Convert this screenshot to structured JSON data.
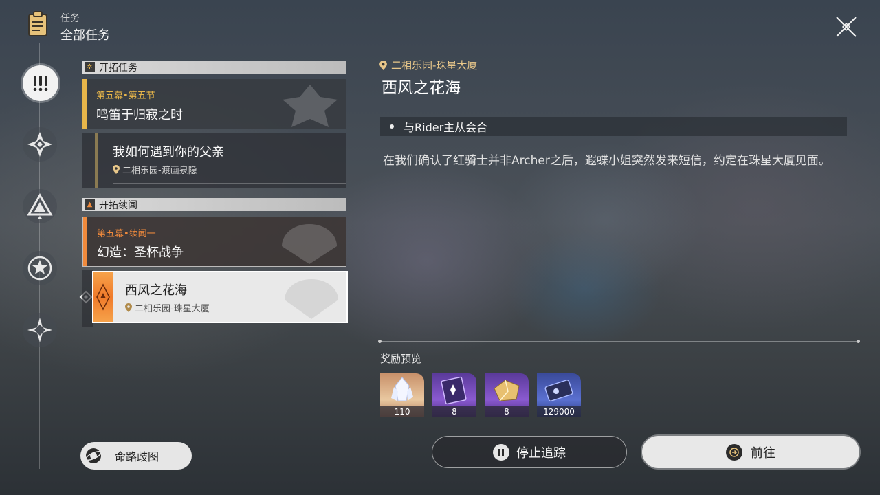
{
  "header": {
    "subtitle": "任务",
    "title": "全部任务",
    "icon": "clipboard-icon",
    "close_icon": "close-icon"
  },
  "rail": {
    "items": [
      {
        "icon": "exclamation-icon",
        "active": true
      },
      {
        "icon": "diamond-star-icon",
        "active": false
      },
      {
        "icon": "triangle-icon",
        "active": false
      },
      {
        "icon": "star-icon",
        "active": false
      },
      {
        "icon": "compass-icon",
        "active": false
      }
    ]
  },
  "sections": [
    {
      "label": "开拓任务",
      "quests": [
        {
          "chapter": "第五幕•第五节",
          "name": "鸣笛于归寂之时"
        },
        {
          "name": "我如何遇到你的父亲",
          "location": "二相乐园-渡画泉隐"
        }
      ]
    },
    {
      "label": "开拓续闻",
      "quests": [
        {
          "chapter": "第五幕•续闻一",
          "name": "幻造：圣杯战争"
        },
        {
          "name": "西风之花海",
          "location": "二相乐园-珠星大厦",
          "selected": true
        }
      ]
    }
  ],
  "detail": {
    "location": "二相乐园-珠星大厦",
    "title": "西风之花海",
    "objective": "与Rider主从会合",
    "description": "在我们确认了红骑士并非Archer之后，遐蝶小姐突然发来短信，约定在珠星大厦见面。",
    "rewards_label": "奖励预览",
    "rewards": [
      {
        "icon": "stellar-jade-icon",
        "qty": "110"
      },
      {
        "icon": "purple-book-icon",
        "qty": "8"
      },
      {
        "icon": "gold-material-icon",
        "qty": "8"
      },
      {
        "icon": "credit-icon",
        "qty": "129000"
      }
    ]
  },
  "buttons": {
    "map": "命路歧图",
    "stop_tracking": "停止追踪",
    "go": "前往"
  },
  "colors": {
    "trailblaze_accent": "#e8b64a",
    "companion_accent": "#f08a3c",
    "location_text": "#e8c78a",
    "button_light": "#e8e8e8"
  }
}
